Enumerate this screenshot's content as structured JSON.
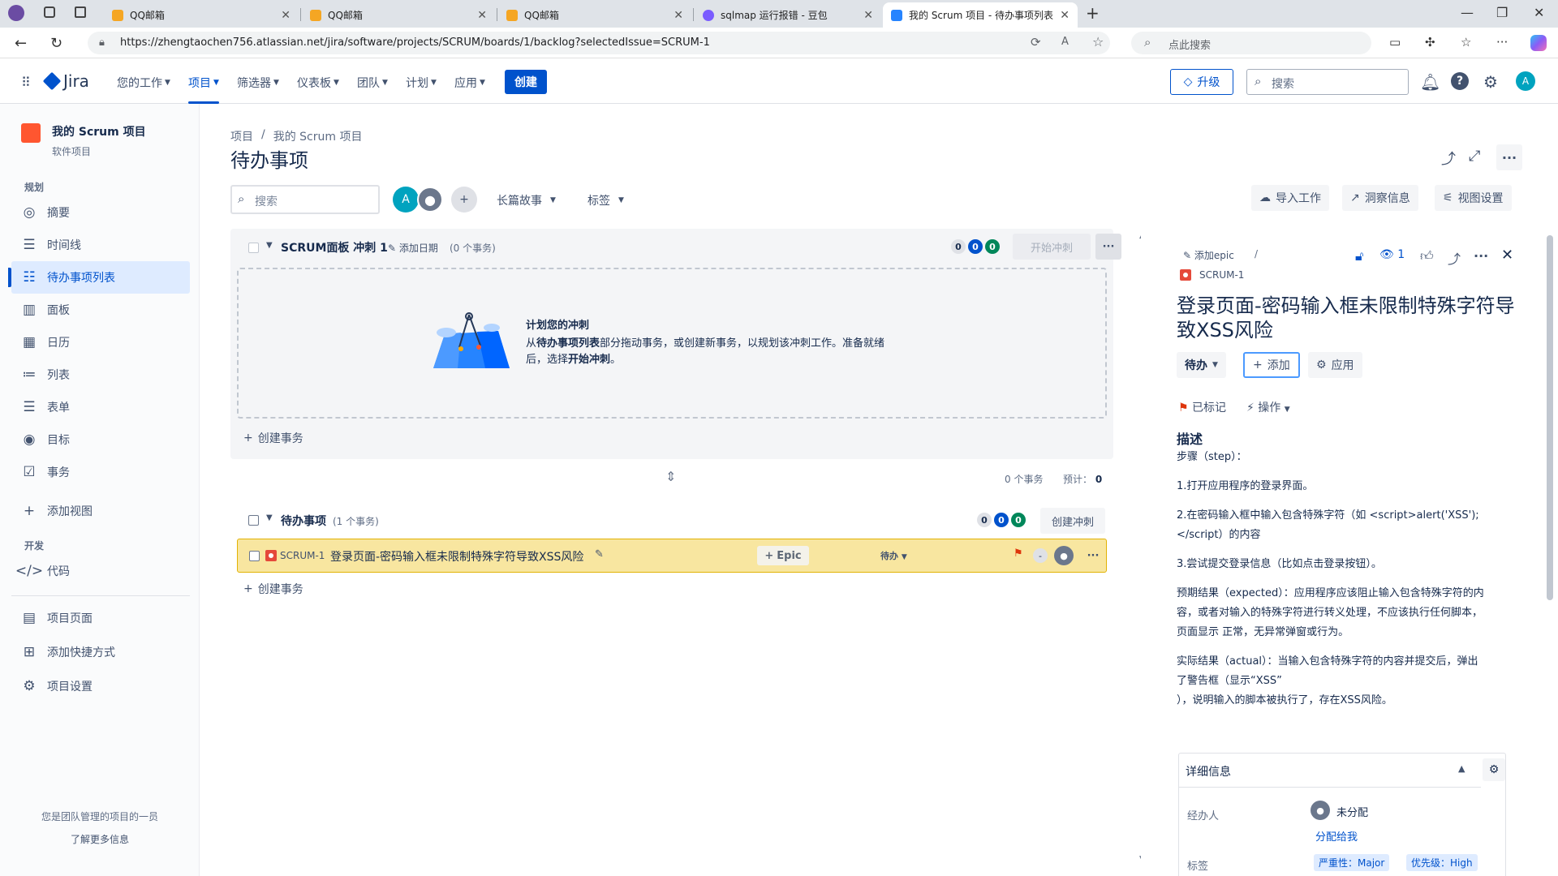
{
  "browser": {
    "tabs": [
      {
        "title": "QQ邮箱"
      },
      {
        "title": "QQ邮箱"
      },
      {
        "title": "QQ邮箱"
      },
      {
        "title": "sqlmap 运行报错 - 豆包"
      },
      {
        "title": "我的 Scrum 项目 - 待办事项列表"
      }
    ],
    "url": "https://zhengtaochen756.atlassian.net/jira/software/projects/SCRUM/boards/1/backlog?selectedIssue=SCRUM-1",
    "search_placeholder": "点此搜索"
  },
  "topnav": {
    "logo": "Jira",
    "items": [
      "您的工作",
      "项目",
      "筛选器",
      "仪表板",
      "团队",
      "计划",
      "应用"
    ],
    "create": "创建",
    "upgrade": "升级",
    "search_placeholder": "搜索",
    "avatar": "A"
  },
  "sidebar": {
    "project_name": "我的 Scrum 项目",
    "project_type": "软件项目",
    "section_plan": "规划",
    "items": [
      "摘要",
      "时间线",
      "待办事项列表",
      "面板",
      "日历",
      "列表",
      "表单",
      "目标",
      "事务",
      "添加视图"
    ],
    "section_dev": "开发",
    "dev_items": [
      "代码"
    ],
    "bottom_items": [
      "项目页面",
      "添加快捷方式",
      "项目设置"
    ],
    "footer_line1": "您是团队管理的项目的一员",
    "footer_line2": "了解更多信息"
  },
  "main": {
    "breadcrumb": [
      "项目",
      "/",
      "我的 Scrum 项目"
    ],
    "title": "待办事项",
    "search_placeholder": "搜索",
    "avatar": "A",
    "filters": [
      "长篇故事",
      "标签"
    ],
    "tools": [
      "导入工作",
      "洞察信息",
      "视图设置"
    ]
  },
  "sprint": {
    "name": "SCRUM面板 冲刺 1",
    "add_date": "添加日期",
    "count": "(0 个事务)",
    "pills": [
      "0",
      "0",
      "0"
    ],
    "start_button": "开始冲刺",
    "empty_title": "计划您的冲刺",
    "empty_text_1a": "从",
    "empty_text_1b": "待办事项列表",
    "empty_text_1c": "部分拖动事务，或创建新事务，以规划该冲刺工作。准备就绪",
    "empty_text_2a": "后，选择",
    "empty_text_2b": "开始冲刺",
    "empty_text_2c": "。",
    "create_issue": "创建事务",
    "summary_count": "0 个事务",
    "estimate_label": "预计：",
    "estimate_value": "0"
  },
  "backlog": {
    "name": "待办事项",
    "count": "(1 个事务)",
    "pills": [
      "0",
      "0",
      "0"
    ],
    "create_sprint": "创建冲刺",
    "issue": {
      "key": "SCRUM-1",
      "summary": "登录页面-密码输入框未限制特殊字符导致XSS风险",
      "epic": "Epic",
      "status": "待办",
      "estimate": "-"
    },
    "create_issue": "创建事务"
  },
  "detail": {
    "add_epic": "添加epic",
    "slash": "/",
    "key": "SCRUM-1",
    "watch_count": "1",
    "title": "登录页面-密码输入框未限制特殊字符导致XSS风险",
    "status": "待办",
    "add": "添加",
    "apps": "应用",
    "flagged": "已标记",
    "actions": "操作",
    "desc_heading": "描述",
    "steps_label": "步骤（step）：",
    "step1": "1.打开应用程序的登录界面。",
    "step2a": "2.在密码输入框中输入包含特殊字符（如 <script>alert('XSS');",
    "step2b": "</script）的内容",
    "step3": "3.尝试提交登录信息（比如点击登录按钮）。",
    "expected1": "预期结果（expected）：应用程序应该阻止输入包含特殊字符的内",
    "expected2": "容，或者对输入的特殊字符进行转义处理，不应该执行任何脚本，",
    "expected3": "页面显示 正常，无异常弹窗或行为。",
    "actual1": "实际结果（actual）：当输入包含特殊字符的内容并提交后，弹出",
    "actual2": "了警告框（显示“XSS”",
    "actual3": "），说明输入的脚本被执行了，存在XSS风险。",
    "details_heading": "详细信息",
    "assignee_label": "经办人",
    "assignee_value": "未分配",
    "assign_me": "分配给我",
    "labels_label": "标签",
    "label1": "严重性：Major",
    "label2": "优先级：High"
  },
  "colors": {
    "brand": "#0052cc",
    "flag": "#de350b",
    "highlight": "#f8e6a0"
  }
}
